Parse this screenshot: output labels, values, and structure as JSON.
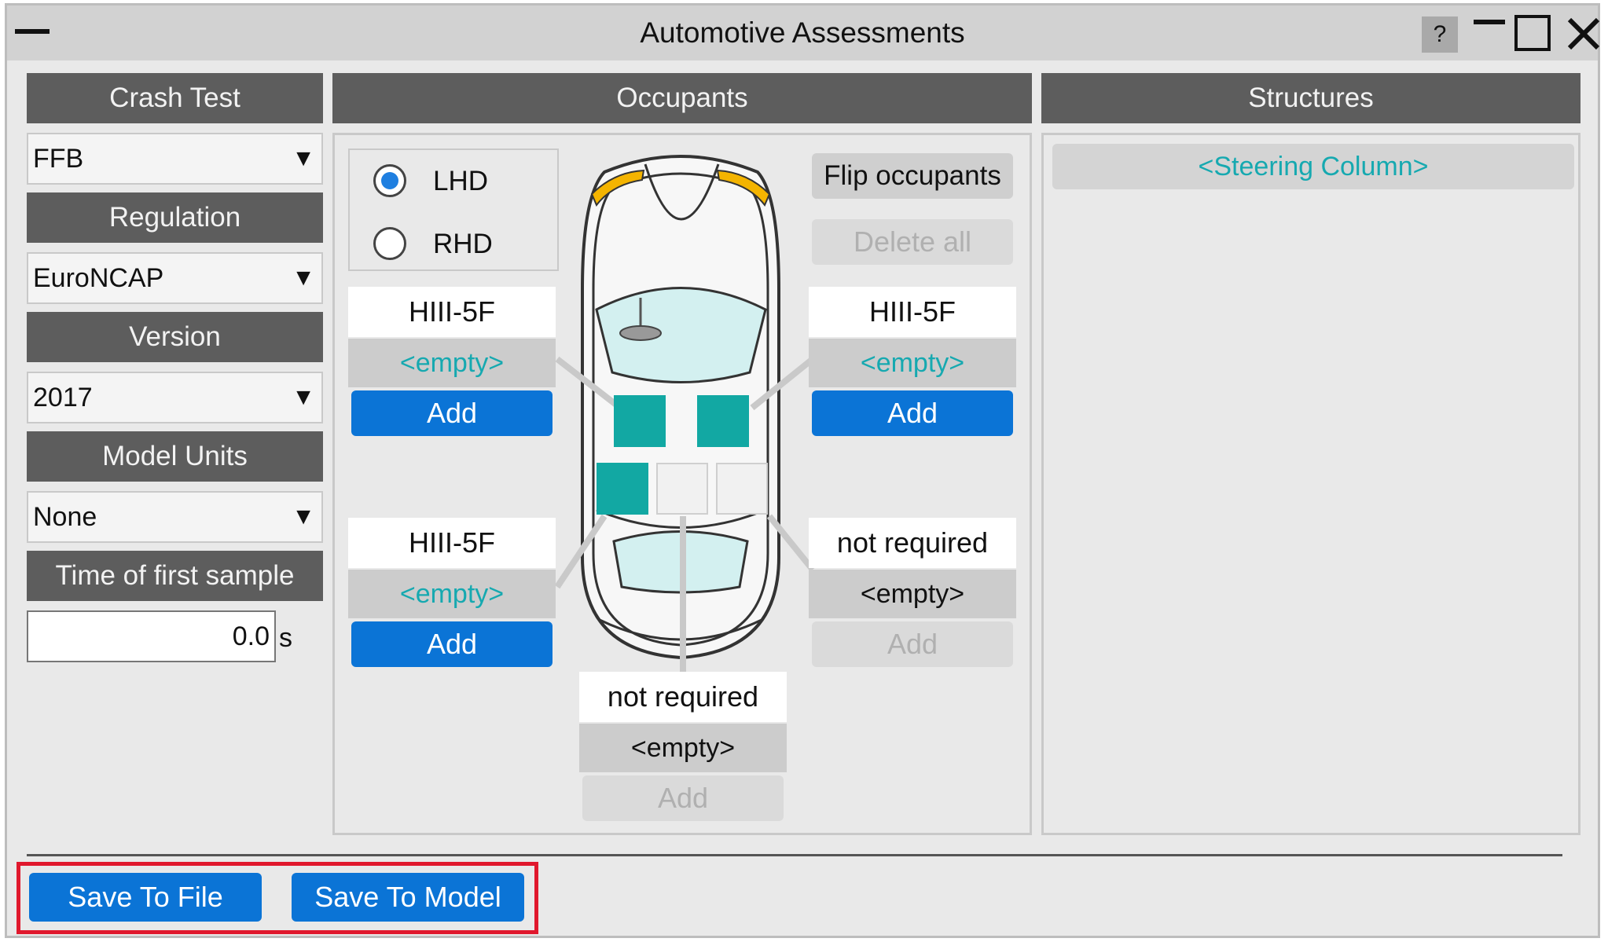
{
  "window": {
    "title": "Automotive Assessments",
    "help_label": "?"
  },
  "left": {
    "crash_test_header": "Crash Test",
    "crash_test_value": "FFB",
    "regulation_header": "Regulation",
    "regulation_value": "EuroNCAP",
    "version_header": "Version",
    "version_value": "2017",
    "model_units_header": "Model Units",
    "model_units_value": "None",
    "time_header": "Time of first sample",
    "time_value": "0.0",
    "time_unit": "s",
    "dropdown_arrow": "▼"
  },
  "occupants": {
    "header": "Occupants",
    "lhd_label": "LHD",
    "rhd_label": "RHD",
    "flip_label": "Flip occupants",
    "delete_all_label": "Delete all",
    "front_left": {
      "dummy": "HIII-5F",
      "value": "<empty>",
      "button": "Add"
    },
    "front_right": {
      "dummy": "HIII-5F",
      "value": "<empty>",
      "button": "Add"
    },
    "rear_left": {
      "dummy": "HIII-5F",
      "value": "<empty>",
      "button": "Add"
    },
    "rear_right": {
      "dummy": "not required",
      "value": "<empty>",
      "button": "Add"
    },
    "rear_middle": {
      "dummy": "not required",
      "value": "<empty>",
      "button": "Add"
    }
  },
  "structures": {
    "header": "Structures",
    "item": "<Steering Column>"
  },
  "footer": {
    "save_file_label": "Save To File",
    "save_model_label": "Save To Model"
  },
  "colors": {
    "accent_blue": "#0b74d6",
    "teal": "#16a9b0",
    "header_gray": "#5d5d5d",
    "highlight_red": "#e0182d"
  }
}
